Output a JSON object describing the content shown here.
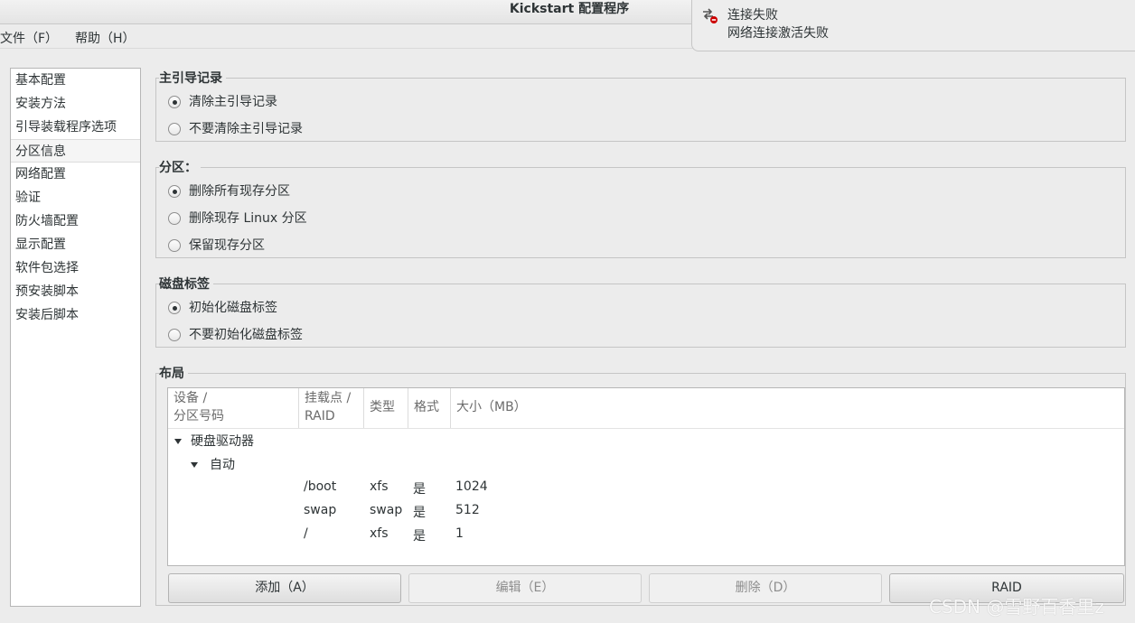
{
  "window": {
    "title": "Kickstart 配置程序"
  },
  "menubar": {
    "items": [
      "文件（F）",
      "帮助（H）"
    ]
  },
  "notification": {
    "icon": "network-error-icon",
    "title": "连接失败",
    "body": "网络连接激活失败"
  },
  "sidebar": {
    "items": [
      "基本配置",
      "安装方法",
      "引导装载程序选项",
      "分区信息",
      "网络配置",
      "验证",
      "防火墙配置",
      "显示配置",
      "软件包选择",
      "预安装脚本",
      "安装后脚本"
    ],
    "selected_index": 3
  },
  "mbr": {
    "title": "主引导记录",
    "options": [
      "清除主引导记录",
      "不要清除主引导记录"
    ],
    "selected": 0
  },
  "partitions": {
    "title": "分区：",
    "options": [
      "删除所有现存分区",
      "删除现存 Linux 分区",
      "保留现存分区"
    ],
    "selected": 0
  },
  "disklabel": {
    "title": "磁盘标签",
    "options": [
      "初始化磁盘标签",
      "不要初始化磁盘标签"
    ],
    "selected": 0
  },
  "layout": {
    "title": "布局",
    "columns": [
      {
        "line1": "设备 /",
        "line2": "分区号码"
      },
      {
        "line1": "挂载点 /",
        "line2": "RAID"
      },
      {
        "line1": "类型",
        "line2": ""
      },
      {
        "line1": "格式",
        "line2": ""
      },
      {
        "line1": "大小（MB）",
        "line2": ""
      }
    ],
    "tree": {
      "drive_label": "硬盘驱动器",
      "group_label": "自动",
      "rows": [
        {
          "mount": "/boot",
          "type": "xfs",
          "format": "是",
          "size": "1024"
        },
        {
          "mount": "swap",
          "type": "swap",
          "format": "是",
          "size": "512"
        },
        {
          "mount": "/",
          "type": "xfs",
          "format": "是",
          "size": "1"
        }
      ]
    }
  },
  "buttons": {
    "add": "添加（A）",
    "edit": "编辑（E）",
    "delete": "删除（D）",
    "raid": "RAID"
  },
  "watermark": "CSDN @雪野百香里z"
}
